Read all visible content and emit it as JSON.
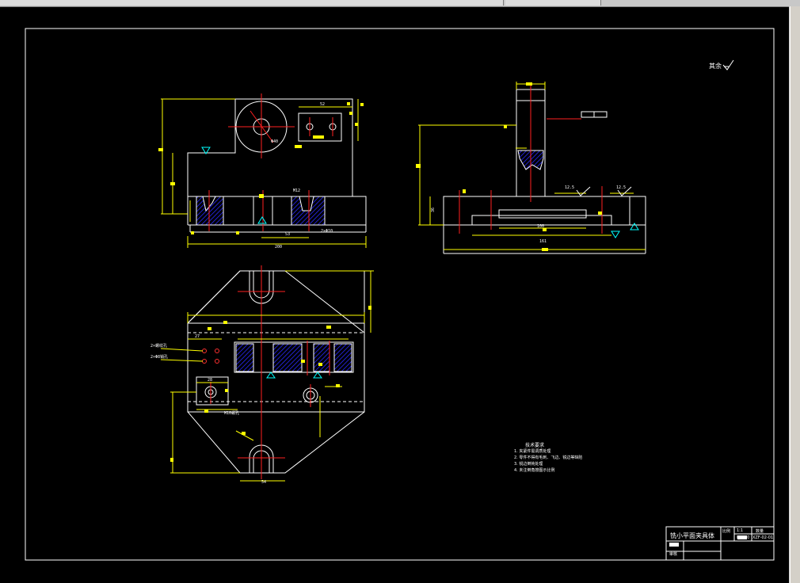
{
  "drawing": {
    "surface_mark": "其余",
    "dims": {
      "d200": "200",
      "d52": "52",
      "d_phi40": "Φ40",
      "d53": "53",
      "d_m12": "M12",
      "d_hole10": "2×Φ10",
      "d100": "100",
      "d161": "161",
      "d27": "27",
      "d28": "28",
      "d54": "54",
      "d36": "36",
      "d_ra_a": "12.5",
      "d_ra_b": "12.5",
      "d_callout_a": "2×螺纹孔",
      "d_callout_b": "2×Φ8销孔",
      "d_m10": "M10螺孔"
    },
    "tech_notes": {
      "title": "技术要求",
      "lines": [
        "1. 夹紧件需调质处理",
        "2. 零件不得有毛刺、飞边、锐边等缺陷",
        "3. 锐边倒钝处理",
        "4. 未注倒角按图示比例"
      ]
    },
    "title_block": {
      "name": "铣小平面夹具体",
      "scale_label": "比例",
      "scale_value": "1:1",
      "qty_label": "数量",
      "drawing_no": "XZF-02-01",
      "material": "HT200",
      "reviewer": "审核"
    },
    "colors": {
      "outline": "#ffffff",
      "dimension": "#ffff00",
      "center": "#ff0000",
      "hatch": "#2020ff",
      "frame": "#ffffff"
    }
  }
}
